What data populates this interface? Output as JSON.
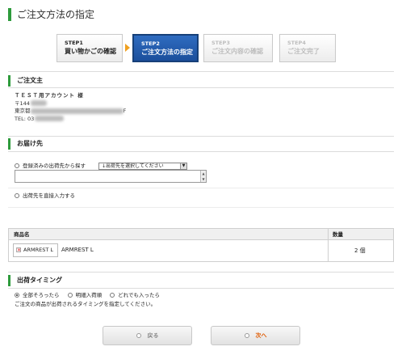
{
  "page": {
    "title": "ご注文方法の指定"
  },
  "steps": [
    {
      "num": "STEP1",
      "name": "買い物かごの確認",
      "state": "done"
    },
    {
      "num": "STEP2",
      "name": "ご注文方法の指定",
      "state": "current"
    },
    {
      "num": "STEP3",
      "name": "ご注文内容の確認",
      "state": "upcoming"
    },
    {
      "num": "STEP4",
      "name": "ご注文完了",
      "state": "upcoming"
    }
  ],
  "customer": {
    "heading": "ご注文主",
    "name": "ＴＥＳＴ用アカウント 様",
    "postal_prefix": "〒144",
    "address_prefix": "東京都",
    "address_suffix": "F",
    "tel_prefix": "TEL: 03"
  },
  "delivery": {
    "heading": "お届け先",
    "option_registered": "登録済みの出荷先から探す",
    "select_value": "↓出荷先を選択してください",
    "option_direct": "出荷先を直接入力する"
  },
  "items_table": {
    "headers": {
      "product": "商品名",
      "quantity": "数量"
    },
    "rows": [
      {
        "image_alt": "ARMREST L",
        "name": "ARMREST L",
        "quantity": "2 個"
      }
    ]
  },
  "timing": {
    "heading": "出荷タイミング",
    "options": [
      "全部そろったら",
      "明細入荷順",
      "どれでも入ったら"
    ],
    "selected": "全部そろったら",
    "note": "ご注文の商品が出荷されるタイミングを指定してください。"
  },
  "buttons": {
    "back": "戻る",
    "next": "次へ"
  },
  "colors": {
    "accent_green": "#2e9b3c",
    "step_active": "#1b4f9c",
    "arrow": "#f0a020",
    "next_text": "#e05a00"
  }
}
